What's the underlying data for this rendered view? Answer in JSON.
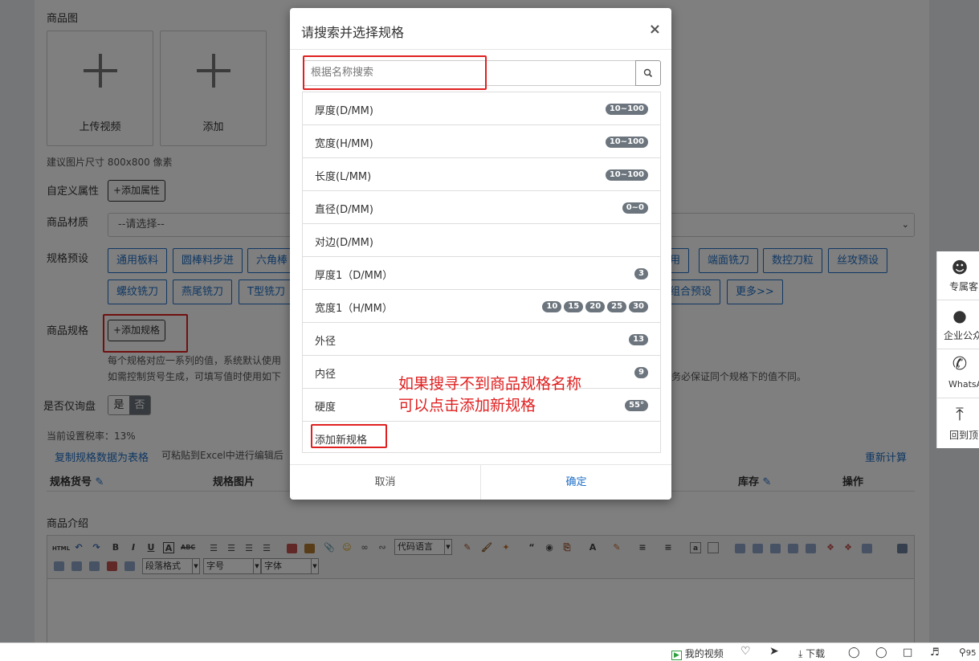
{
  "form": {
    "image_label": "商品图",
    "upload_video": "上传视频",
    "add_image": "添加",
    "image_hint": "建议图片尺寸 800x800 像素",
    "custom_attr_label": "自定义属性",
    "add_attr_button": "+添加属性",
    "material_label": "商品材质",
    "material_value": "--请选择--",
    "preset_label": "规格预设",
    "presets_row1": [
      "通用板料",
      "圆棒料步进",
      "六角棒",
      "用",
      "端面铣刀",
      "数控刀粒",
      "丝攻预设"
    ],
    "presets_row2": [
      "螺纹铣刀",
      "燕尾铣刀",
      "T型铣刀",
      "组合预设",
      "更多>>"
    ],
    "spec_label": "商品规格",
    "add_spec_button": "+添加规格",
    "spec_note_1": "每个规格对应一系列的值，系统默认使用",
    "spec_note_2": "如需控制货号生成，可填写值时使用如下",
    "spec_note_3": "务必保证同个规格下的值不同。",
    "inquiry_label": "是否仅询盘",
    "inquiry_yes": "是",
    "inquiry_no": "否",
    "tax_text": "当前设置税率：13%",
    "copy_link": "复制规格数据为表格",
    "excel_hint": "可粘贴到Excel中进行编辑后",
    "recalc_link": "重新计算",
    "table_headers": [
      "规格货号",
      "规格图片",
      "库存",
      "操作"
    ],
    "intro_label": "商品介绍"
  },
  "editor": {
    "code_lang": "代码语言",
    "para_format": "段落格式",
    "font_size": "字号",
    "font_family": "字体",
    "html_btn": "HTML"
  },
  "side_panel": {
    "items": [
      "专属客",
      "企业公众",
      "WhatsA",
      "回到顶"
    ]
  },
  "modal": {
    "title": "请搜索并选择规格",
    "close": "×",
    "search_placeholder": "根据名称搜索",
    "specs": [
      {
        "name": "厚度(D/MM)",
        "badges": [
          "10~100"
        ]
      },
      {
        "name": "宽度(H/MM)",
        "badges": [
          "10~100"
        ]
      },
      {
        "name": "长度(L/MM)",
        "badges": [
          "10~100"
        ]
      },
      {
        "name": "直径(D/MM)",
        "badges": [
          "0~0"
        ]
      },
      {
        "name": "对边(D/MM)",
        "badges": []
      },
      {
        "name": "厚度1（D/MM）",
        "badges": [
          "3"
        ]
      },
      {
        "name": "宽度1（H/MM）",
        "badges": [
          "10",
          "15",
          "20",
          "25",
          "30"
        ]
      },
      {
        "name": "外径",
        "badges": [
          "13"
        ]
      },
      {
        "name": "内径",
        "badges": [
          "9"
        ]
      },
      {
        "name": "硬度",
        "badges": [
          "55°"
        ]
      }
    ],
    "add_new": "添加新规格",
    "cancel": "取消",
    "confirm": "确定"
  },
  "annotation": {
    "line1": "如果搜寻不到商品规格名称",
    "line2": "可以点击添加新规格"
  },
  "statusbar": {
    "my_video": "我的视频",
    "download": "下载",
    "zoom": "95"
  },
  "colors": {
    "accent": "#1e6fc7",
    "annotation_red": "#e02020",
    "badge": "#6c757d"
  }
}
